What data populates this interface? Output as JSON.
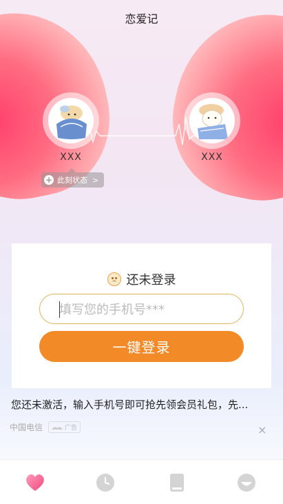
{
  "header": {
    "title": "恋爱记"
  },
  "couple": {
    "left_name": "XXX",
    "right_name": "XXX",
    "status_label": "此刻状态",
    "status_arrow": ">"
  },
  "login_card": {
    "title": "还未登录",
    "phone_placeholder": "填写您的手机号***",
    "login_button": "一键登录"
  },
  "ad": {
    "text": "您还未激活，输入手机号即可抢先领会员礼包，先...",
    "source": "中国电信",
    "badge": "广告",
    "close": "×"
  },
  "tabbar": {
    "items": [
      "love-icon",
      "clock-icon",
      "book-icon",
      "face-icon"
    ],
    "active_color": "#f06a8f",
    "inactive_color": "#cfcfcf"
  },
  "colors": {
    "accent_orange": "#f28a28",
    "heart_pink": "#ff4f73"
  }
}
